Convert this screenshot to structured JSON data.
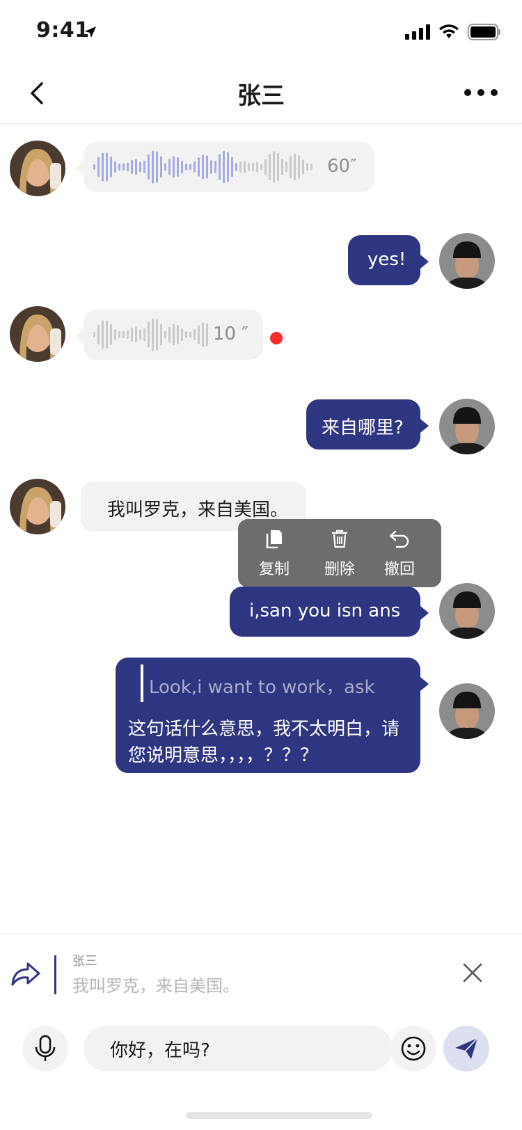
{
  "status_bar": {
    "time": "9:41"
  },
  "nav": {
    "title": "张三"
  },
  "messages": {
    "m1": {
      "duration": "60″"
    },
    "m2": {
      "text": "yes!"
    },
    "m3": {
      "duration": "10 ″"
    },
    "m4": {
      "text": "来自哪里?"
    },
    "m5": {
      "text": "我叫罗克，来自美国。"
    },
    "m6": {
      "text": "i,san you isn ans"
    },
    "m7": {
      "quote": "Look,i want to work，ask",
      "line1": "这句话什么意思，我不太明白，请",
      "line2": "您说明意思，，，，？？？"
    }
  },
  "context_menu": {
    "copy": "复制",
    "delete": "删除",
    "recall": "撤回"
  },
  "quote_bar": {
    "name": "张三",
    "text": "我叫罗克，来自美国。"
  },
  "input": {
    "value": "你好，在吗?"
  },
  "colors": {
    "accent": "#2f3681",
    "bubble_in": "#f2f2f2",
    "unread": "#ff2a2a",
    "menu": "#6d6d6d"
  }
}
